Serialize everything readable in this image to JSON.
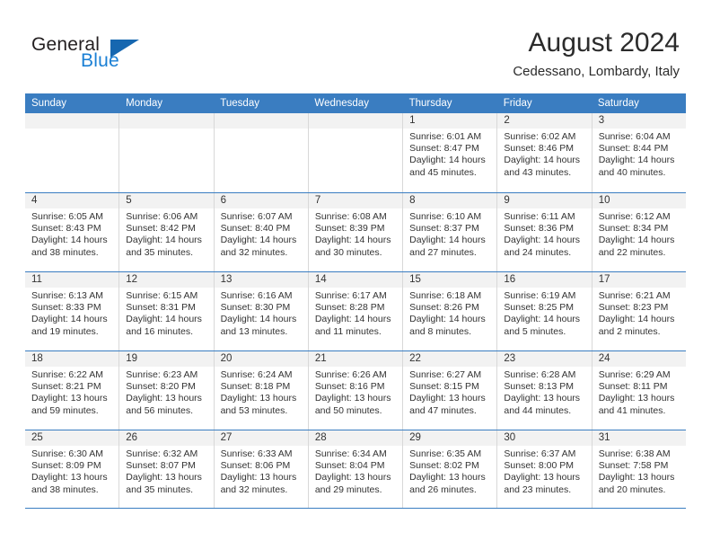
{
  "brand": {
    "name_top": "General",
    "name_bottom": "Blue",
    "triangle_color": "#1667b0",
    "blue_color": "#1a7fd4"
  },
  "header": {
    "title": "August 2024",
    "subtitle": "Cedessano, Lombardy, Italy"
  },
  "theme": {
    "header_blue": "#3a7dc1",
    "date_band": "#f2f2f2",
    "cell_border": "#d8d8d8",
    "text": "#333333"
  },
  "weekdays": [
    "Sunday",
    "Monday",
    "Tuesday",
    "Wednesday",
    "Thursday",
    "Friday",
    "Saturday"
  ],
  "weeks": [
    [
      {
        "day": "",
        "sunrise": "",
        "sunset": "",
        "daylight_line1": "",
        "daylight_line2": ""
      },
      {
        "day": "",
        "sunrise": "",
        "sunset": "",
        "daylight_line1": "",
        "daylight_line2": ""
      },
      {
        "day": "",
        "sunrise": "",
        "sunset": "",
        "daylight_line1": "",
        "daylight_line2": ""
      },
      {
        "day": "",
        "sunrise": "",
        "sunset": "",
        "daylight_line1": "",
        "daylight_line2": ""
      },
      {
        "day": "1",
        "sunrise": "Sunrise: 6:01 AM",
        "sunset": "Sunset: 8:47 PM",
        "daylight_line1": "Daylight: 14 hours",
        "daylight_line2": "and 45 minutes."
      },
      {
        "day": "2",
        "sunrise": "Sunrise: 6:02 AM",
        "sunset": "Sunset: 8:46 PM",
        "daylight_line1": "Daylight: 14 hours",
        "daylight_line2": "and 43 minutes."
      },
      {
        "day": "3",
        "sunrise": "Sunrise: 6:04 AM",
        "sunset": "Sunset: 8:44 PM",
        "daylight_line1": "Daylight: 14 hours",
        "daylight_line2": "and 40 minutes."
      }
    ],
    [
      {
        "day": "4",
        "sunrise": "Sunrise: 6:05 AM",
        "sunset": "Sunset: 8:43 PM",
        "daylight_line1": "Daylight: 14 hours",
        "daylight_line2": "and 38 minutes."
      },
      {
        "day": "5",
        "sunrise": "Sunrise: 6:06 AM",
        "sunset": "Sunset: 8:42 PM",
        "daylight_line1": "Daylight: 14 hours",
        "daylight_line2": "and 35 minutes."
      },
      {
        "day": "6",
        "sunrise": "Sunrise: 6:07 AM",
        "sunset": "Sunset: 8:40 PM",
        "daylight_line1": "Daylight: 14 hours",
        "daylight_line2": "and 32 minutes."
      },
      {
        "day": "7",
        "sunrise": "Sunrise: 6:08 AM",
        "sunset": "Sunset: 8:39 PM",
        "daylight_line1": "Daylight: 14 hours",
        "daylight_line2": "and 30 minutes."
      },
      {
        "day": "8",
        "sunrise": "Sunrise: 6:10 AM",
        "sunset": "Sunset: 8:37 PM",
        "daylight_line1": "Daylight: 14 hours",
        "daylight_line2": "and 27 minutes."
      },
      {
        "day": "9",
        "sunrise": "Sunrise: 6:11 AM",
        "sunset": "Sunset: 8:36 PM",
        "daylight_line1": "Daylight: 14 hours",
        "daylight_line2": "and 24 minutes."
      },
      {
        "day": "10",
        "sunrise": "Sunrise: 6:12 AM",
        "sunset": "Sunset: 8:34 PM",
        "daylight_line1": "Daylight: 14 hours",
        "daylight_line2": "and 22 minutes."
      }
    ],
    [
      {
        "day": "11",
        "sunrise": "Sunrise: 6:13 AM",
        "sunset": "Sunset: 8:33 PM",
        "daylight_line1": "Daylight: 14 hours",
        "daylight_line2": "and 19 minutes."
      },
      {
        "day": "12",
        "sunrise": "Sunrise: 6:15 AM",
        "sunset": "Sunset: 8:31 PM",
        "daylight_line1": "Daylight: 14 hours",
        "daylight_line2": "and 16 minutes."
      },
      {
        "day": "13",
        "sunrise": "Sunrise: 6:16 AM",
        "sunset": "Sunset: 8:30 PM",
        "daylight_line1": "Daylight: 14 hours",
        "daylight_line2": "and 13 minutes."
      },
      {
        "day": "14",
        "sunrise": "Sunrise: 6:17 AM",
        "sunset": "Sunset: 8:28 PM",
        "daylight_line1": "Daylight: 14 hours",
        "daylight_line2": "and 11 minutes."
      },
      {
        "day": "15",
        "sunrise": "Sunrise: 6:18 AM",
        "sunset": "Sunset: 8:26 PM",
        "daylight_line1": "Daylight: 14 hours",
        "daylight_line2": "and 8 minutes."
      },
      {
        "day": "16",
        "sunrise": "Sunrise: 6:19 AM",
        "sunset": "Sunset: 8:25 PM",
        "daylight_line1": "Daylight: 14 hours",
        "daylight_line2": "and 5 minutes."
      },
      {
        "day": "17",
        "sunrise": "Sunrise: 6:21 AM",
        "sunset": "Sunset: 8:23 PM",
        "daylight_line1": "Daylight: 14 hours",
        "daylight_line2": "and 2 minutes."
      }
    ],
    [
      {
        "day": "18",
        "sunrise": "Sunrise: 6:22 AM",
        "sunset": "Sunset: 8:21 PM",
        "daylight_line1": "Daylight: 13 hours",
        "daylight_line2": "and 59 minutes."
      },
      {
        "day": "19",
        "sunrise": "Sunrise: 6:23 AM",
        "sunset": "Sunset: 8:20 PM",
        "daylight_line1": "Daylight: 13 hours",
        "daylight_line2": "and 56 minutes."
      },
      {
        "day": "20",
        "sunrise": "Sunrise: 6:24 AM",
        "sunset": "Sunset: 8:18 PM",
        "daylight_line1": "Daylight: 13 hours",
        "daylight_line2": "and 53 minutes."
      },
      {
        "day": "21",
        "sunrise": "Sunrise: 6:26 AM",
        "sunset": "Sunset: 8:16 PM",
        "daylight_line1": "Daylight: 13 hours",
        "daylight_line2": "and 50 minutes."
      },
      {
        "day": "22",
        "sunrise": "Sunrise: 6:27 AM",
        "sunset": "Sunset: 8:15 PM",
        "daylight_line1": "Daylight: 13 hours",
        "daylight_line2": "and 47 minutes."
      },
      {
        "day": "23",
        "sunrise": "Sunrise: 6:28 AM",
        "sunset": "Sunset: 8:13 PM",
        "daylight_line1": "Daylight: 13 hours",
        "daylight_line2": "and 44 minutes."
      },
      {
        "day": "24",
        "sunrise": "Sunrise: 6:29 AM",
        "sunset": "Sunset: 8:11 PM",
        "daylight_line1": "Daylight: 13 hours",
        "daylight_line2": "and 41 minutes."
      }
    ],
    [
      {
        "day": "25",
        "sunrise": "Sunrise: 6:30 AM",
        "sunset": "Sunset: 8:09 PM",
        "daylight_line1": "Daylight: 13 hours",
        "daylight_line2": "and 38 minutes."
      },
      {
        "day": "26",
        "sunrise": "Sunrise: 6:32 AM",
        "sunset": "Sunset: 8:07 PM",
        "daylight_line1": "Daylight: 13 hours",
        "daylight_line2": "and 35 minutes."
      },
      {
        "day": "27",
        "sunrise": "Sunrise: 6:33 AM",
        "sunset": "Sunset: 8:06 PM",
        "daylight_line1": "Daylight: 13 hours",
        "daylight_line2": "and 32 minutes."
      },
      {
        "day": "28",
        "sunrise": "Sunrise: 6:34 AM",
        "sunset": "Sunset: 8:04 PM",
        "daylight_line1": "Daylight: 13 hours",
        "daylight_line2": "and 29 minutes."
      },
      {
        "day": "29",
        "sunrise": "Sunrise: 6:35 AM",
        "sunset": "Sunset: 8:02 PM",
        "daylight_line1": "Daylight: 13 hours",
        "daylight_line2": "and 26 minutes."
      },
      {
        "day": "30",
        "sunrise": "Sunrise: 6:37 AM",
        "sunset": "Sunset: 8:00 PM",
        "daylight_line1": "Daylight: 13 hours",
        "daylight_line2": "and 23 minutes."
      },
      {
        "day": "31",
        "sunrise": "Sunrise: 6:38 AM",
        "sunset": "Sunset: 7:58 PM",
        "daylight_line1": "Daylight: 13 hours",
        "daylight_line2": "and 20 minutes."
      }
    ]
  ]
}
